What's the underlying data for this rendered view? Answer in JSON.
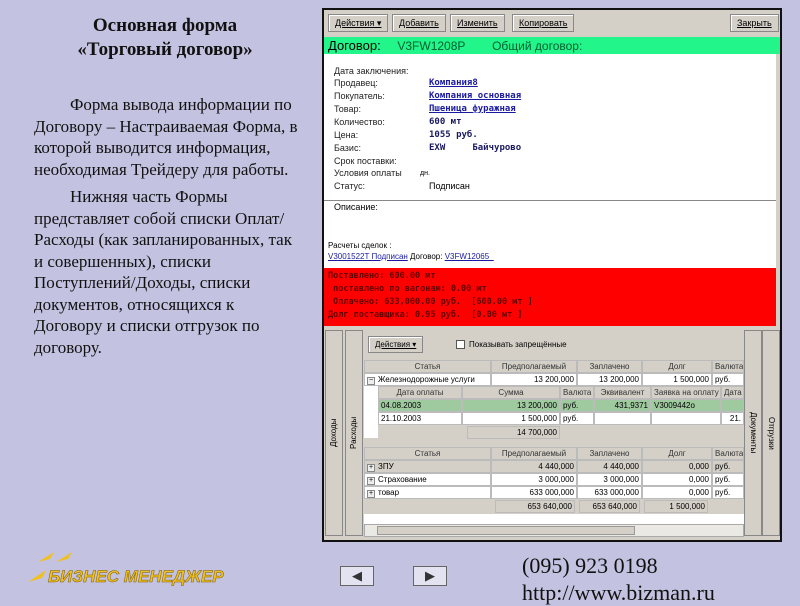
{
  "slide": {
    "title_line1": "Основная форма",
    "title_line2": "«Торговый договор»",
    "para1": "Форма вывода информации по Договору – Настраиваемая Форма, в которой выводится информация, необходимая Трейдеру для работы.",
    "para2": "Нижняя часть Формы представляет собой списки Оплат/Расходы (как запланированных, так и совершенных), списки Поступлений/Доходы, списки документов, относящихся к Договору и списки отгрузок по договору.",
    "logo_text": "БИЗНЕС МЕНЕДЖЕР",
    "phone": "(095) 923 0198",
    "url": "http://www.bizman.ru",
    "prev": "◀",
    "next": "▶"
  },
  "toolbar": {
    "actions": "Действия ▾",
    "add": "Добавить",
    "edit": "Изменить",
    "copy": "Копировать",
    "close": "Закрыть"
  },
  "header": {
    "label": "Договор:",
    "number": "V3FW1208P",
    "general": "Общий договор:"
  },
  "fields": [
    {
      "label": "Дата заключения:",
      "value": ""
    },
    {
      "label": "Продавец:",
      "value": "Компания8"
    },
    {
      "label": "Покупатель:",
      "value": "Компания_основная"
    },
    {
      "label": "Товар:",
      "value": "Пшеница фуражная"
    },
    {
      "label": "Количество:",
      "value": "600  мт"
    },
    {
      "label": "Цена:",
      "value": "1055  руб."
    },
    {
      "label": "Базис:",
      "value": "EXW     Байчурово"
    },
    {
      "label": "Срок поставки:",
      "value": ""
    },
    {
      "label": "Условия оплаты",
      "value": "дн."
    },
    {
      "label": "Статус:",
      "value": "Подписан"
    }
  ],
  "description_label": "Описание:",
  "settlements": {
    "label": "Расчеты сделок :",
    "link1": "V3001522T Подписан",
    "mid": "Договор:",
    "link2": "V3FW12065_"
  },
  "summary": [
    "Поставлено: 600.00 мт",
    " поставлено по вагонам: 0.00 мт",
    " Оплачено: 633,000.00 руб.  [600.00 мт ]",
    "Долг поставщика: 0.95 руб.  [0.00 мт ]"
  ],
  "tabs": {
    "income": "Доходы",
    "expenses": "Расходы",
    "documents": "Документы",
    "shipments": "Отгрузки"
  },
  "grid": {
    "actions": "Действия ▾",
    "show_forbidden": "Показывать запрещённые",
    "headers": [
      "Статья",
      "Предполагаемый",
      "Заплачено",
      "Долг",
      "Валюта"
    ],
    "row1": [
      "Железнодорожные услуги",
      "13 200,000",
      "13 200,000",
      "1 500,000",
      "руб."
    ],
    "sub_headers": [
      "Дата оплаты",
      "Сумма",
      "Валюта",
      "Эквивалент",
      "Заявка на оплату",
      "Дата"
    ],
    "sub_rows": [
      [
        "04.08.2003",
        "13 200,000",
        "руб.",
        "431,9371",
        "V3009442o",
        ""
      ],
      [
        "21.10.2003",
        "1 500,000",
        "руб.",
        "",
        "",
        "21."
      ]
    ],
    "sub_total": "14 700,000",
    "rows2": [
      [
        "ЗПУ",
        "4 440,000",
        "4 440,000",
        "0,000",
        "руб."
      ],
      [
        "Страхование",
        "3 000,000",
        "3 000,000",
        "0,000",
        "руб."
      ],
      [
        "товар",
        "633 000,000",
        "633 000,000",
        "0,000",
        "руб."
      ]
    ],
    "totals": [
      "653 640,000",
      "653 640,000",
      "1 500,000"
    ]
  }
}
